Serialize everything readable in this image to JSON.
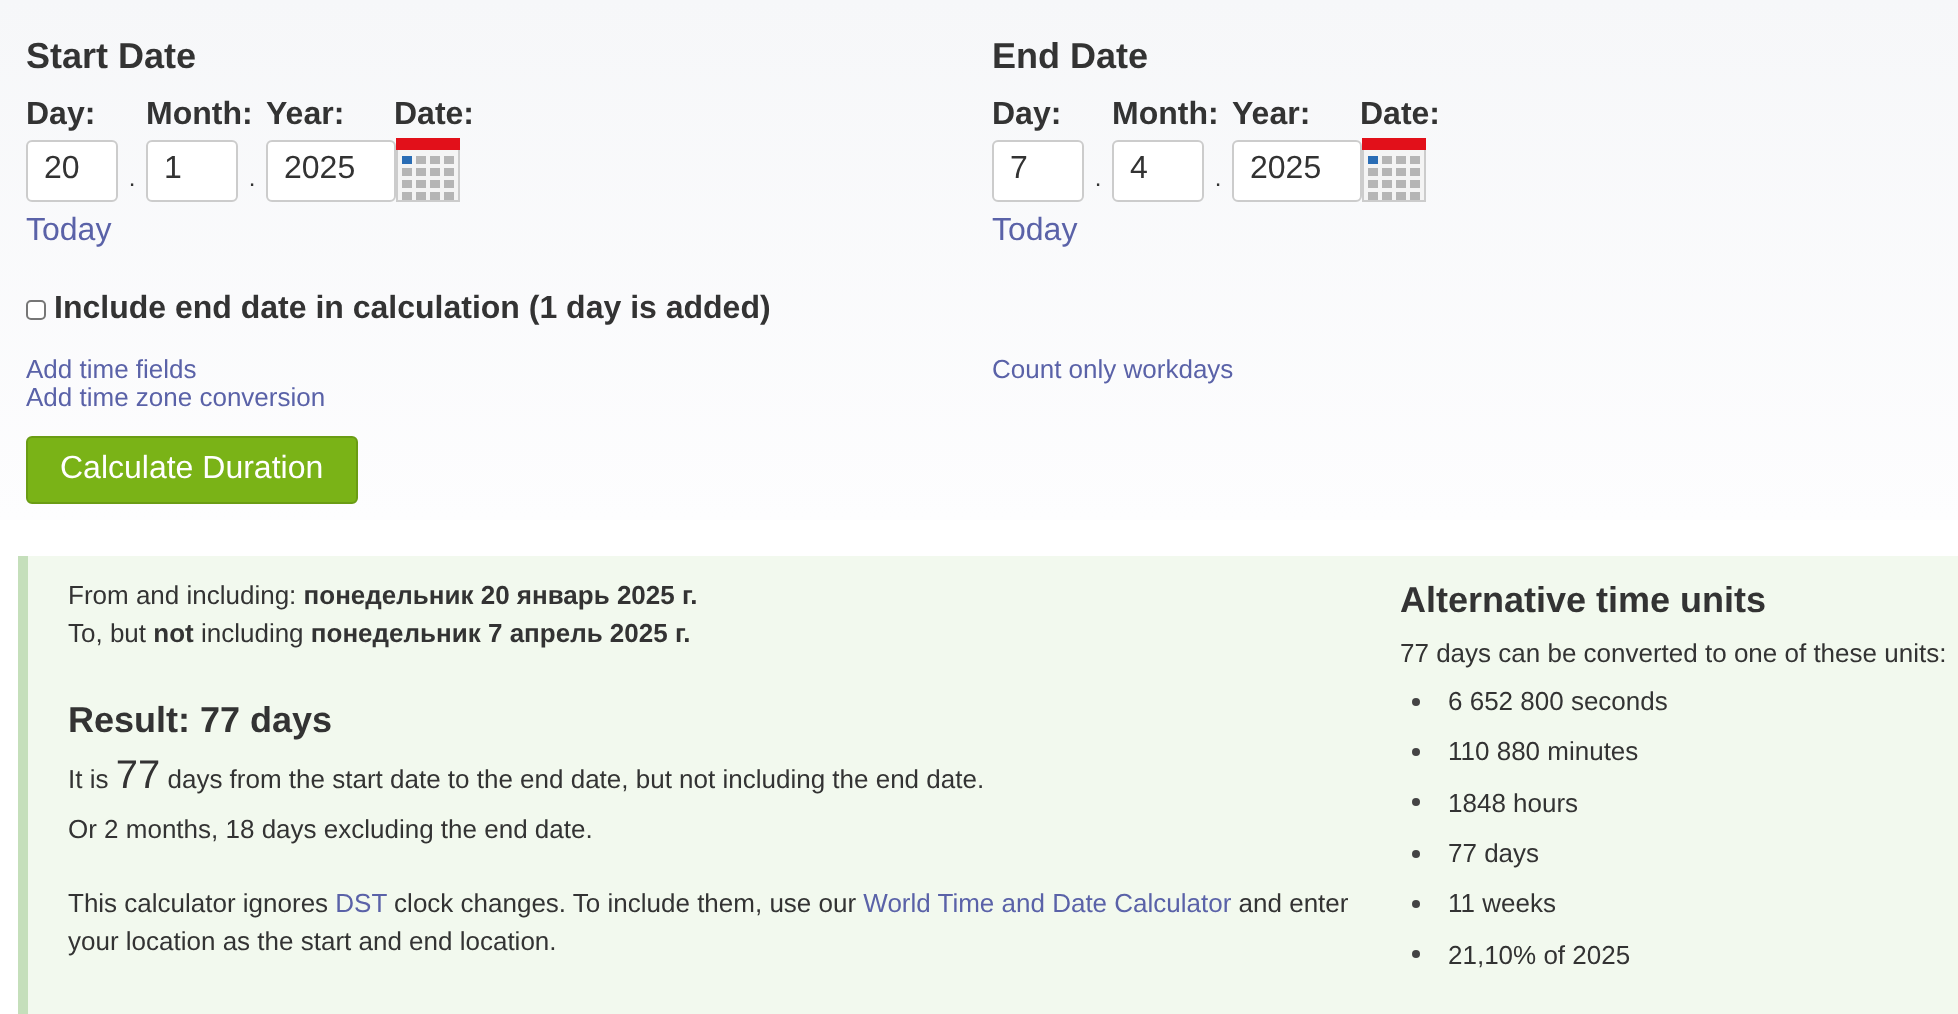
{
  "start_date": {
    "heading": "Start Date",
    "labels": [
      "Day:",
      "Month:",
      "Year:",
      "Date:"
    ],
    "day": "20",
    "month": "1",
    "year": "2025",
    "separator": ".",
    "today_link": "Today"
  },
  "end_date": {
    "heading": "End Date",
    "labels": [
      "Day:",
      "Month:",
      "Year:",
      "Date:"
    ],
    "day": "7",
    "month": "4",
    "year": "2025",
    "separator": ".",
    "today_link": "Today"
  },
  "include_end_date": {
    "label": "Include end date in calculation (1 day is added)",
    "checked": false
  },
  "left_links": [
    "Add time fields",
    "Add time zone conversion"
  ],
  "right_links": [
    "Count only workdays"
  ],
  "calculate_button": "Calculate Duration",
  "result": {
    "from_line": "From and including: **понедельник 20 январь 2025 г.**",
    "to_line": "To, but **not** including **понедельник 7 апрель 2025 г.**",
    "heading": "Result: 77 days",
    "sentence": {
      "before": "It is",
      "number": "77",
      "after": "days from the start date to the end date, but not including the end date."
    },
    "months_line": "Or 2 months, 18 days excluding the end date.",
    "note": [
      {
        "kind": "text",
        "text": "This calculator ignores "
      },
      {
        "kind": "link",
        "text": "DST"
      },
      {
        "kind": "text",
        "text": " clock changes. To include them, use our "
      },
      {
        "kind": "link",
        "text": "World Time and Date Calculator"
      },
      {
        "kind": "text",
        "text": " and enter your location as the start and end location."
      }
    ]
  },
  "alternative": {
    "heading": "Alternative time units",
    "intro": "77 days can be converted to one of these units:",
    "units": [
      "6 652 800 seconds",
      "110 880 minutes",
      "1848 hours",
      "77 days",
      "11 weeks",
      "21,10% of 2025"
    ]
  }
}
